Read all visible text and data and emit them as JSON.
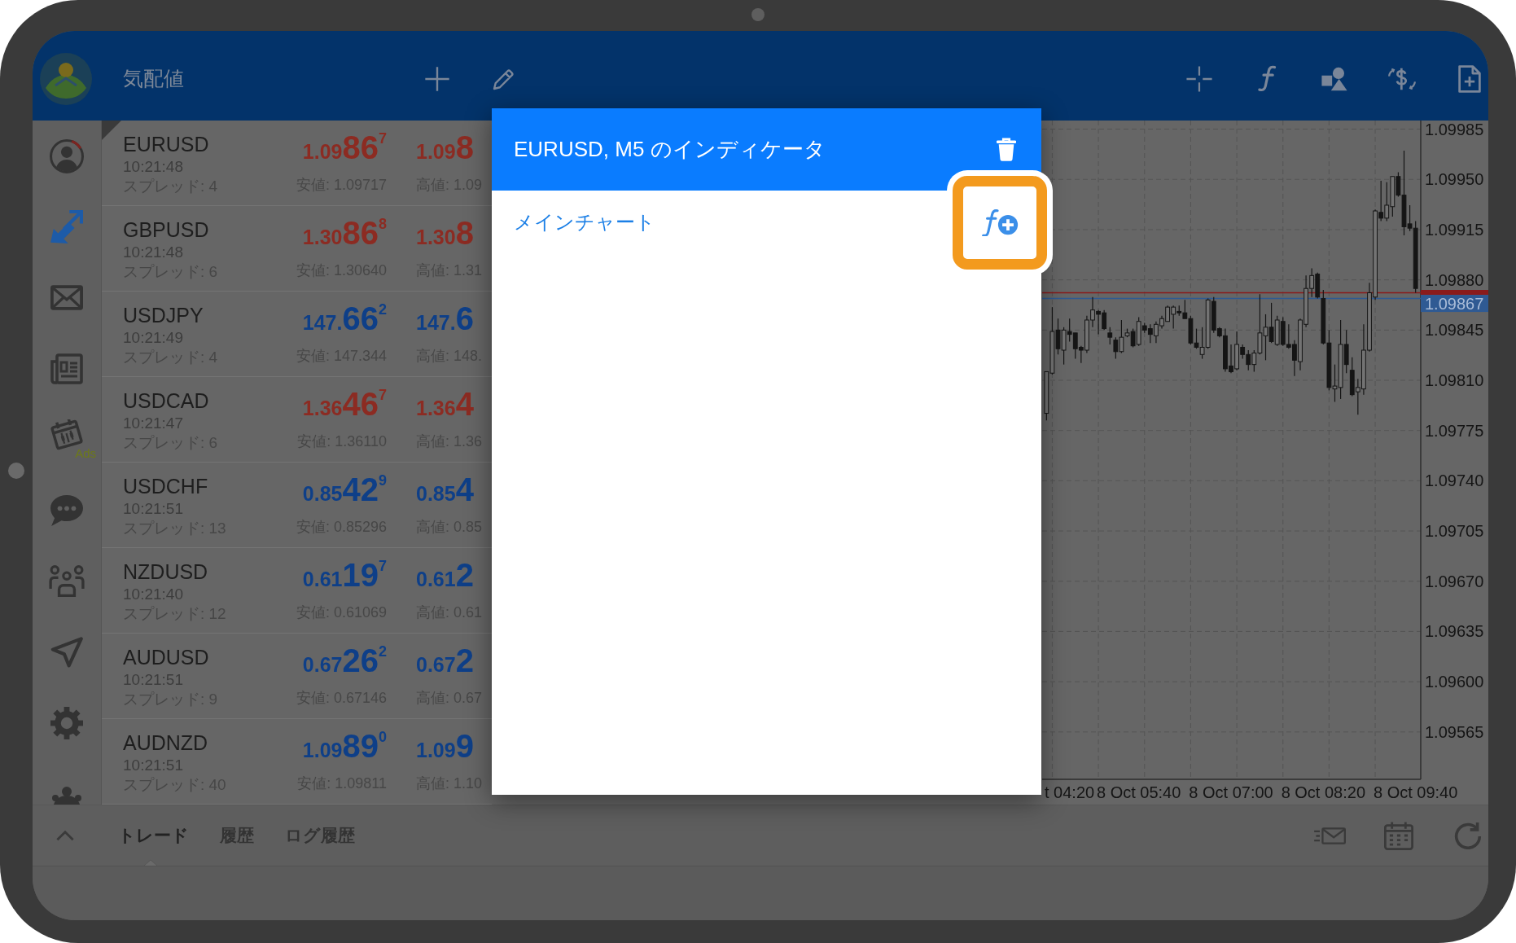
{
  "header": {
    "title": "気配値"
  },
  "sidebar": {
    "items": [
      {
        "selected": false
      },
      {
        "selected": true
      },
      {
        "selected": false
      },
      {
        "selected": false
      },
      {
        "selected": false,
        "badge": "Ads"
      },
      {
        "selected": false
      },
      {
        "selected": false
      },
      {
        "selected": false
      },
      {
        "selected": false
      },
      {
        "selected": false
      }
    ]
  },
  "quotes": [
    {
      "symbol": "EURUSD",
      "time": "10:21:48",
      "spread": "スプレッド: 4",
      "color": "#8c2b22",
      "selected": true,
      "bid": {
        "lead": "1.09",
        "big": "86",
        "sup": "7"
      },
      "low": "安値: 1.09717",
      "ask": {
        "lead": "1.09",
        "big": "8"
      },
      "high": "高値: 1.09"
    },
    {
      "symbol": "GBPUSD",
      "time": "10:21:48",
      "spread": "スプレッド: 6",
      "color": "#8c2b22",
      "selected": false,
      "bid": {
        "lead": "1.30",
        "big": "86",
        "sup": "8"
      },
      "low": "安値: 1.30640",
      "ask": {
        "lead": "1.30",
        "big": "8"
      },
      "high": "高値: 1.31"
    },
    {
      "symbol": "USDJPY",
      "time": "10:21:49",
      "spread": "スプレッド: 4",
      "color": "#0e3f88",
      "selected": false,
      "bid": {
        "lead": "147.",
        "big": "66",
        "sup": "2"
      },
      "low": "安値: 147.344",
      "ask": {
        "lead": "147.",
        "big": "6"
      },
      "high": "高値: 148."
    },
    {
      "symbol": "USDCAD",
      "time": "10:21:47",
      "spread": "スプレッド: 6",
      "color": "#8c2b22",
      "selected": false,
      "bid": {
        "lead": "1.36",
        "big": "46",
        "sup": "7"
      },
      "low": "安値: 1.36110",
      "ask": {
        "lead": "1.36",
        "big": "4"
      },
      "high": "高値: 1.36"
    },
    {
      "symbol": "USDCHF",
      "time": "10:21:51",
      "spread": "スプレッド: 13",
      "color": "#0e3f88",
      "selected": false,
      "bid": {
        "lead": "0.85",
        "big": "42",
        "sup": "9"
      },
      "low": "安値: 0.85296",
      "ask": {
        "lead": "0.85",
        "big": "4"
      },
      "high": "高値: 0.85"
    },
    {
      "symbol": "NZDUSD",
      "time": "10:21:40",
      "spread": "スプレッド: 12",
      "color": "#0e3f88",
      "selected": false,
      "bid": {
        "lead": "0.61",
        "big": "19",
        "sup": "7"
      },
      "low": "安値: 0.61069",
      "ask": {
        "lead": "0.61",
        "big": "2"
      },
      "high": "高値: 0.61"
    },
    {
      "symbol": "AUDUSD",
      "time": "10:21:51",
      "spread": "スプレッド: 9",
      "color": "#0e3f88",
      "selected": false,
      "bid": {
        "lead": "0.67",
        "big": "26",
        "sup": "2"
      },
      "low": "安値: 0.67146",
      "ask": {
        "lead": "0.67",
        "big": "2"
      },
      "high": "高値: 0.67"
    },
    {
      "symbol": "AUDNZD",
      "time": "10:21:51",
      "spread": "スプレッド: 40",
      "color": "#0e3f88",
      "selected": false,
      "bid": {
        "lead": "1.09",
        "big": "89",
        "sup": "0"
      },
      "low": "安値: 1.09811",
      "ask": {
        "lead": "1.09",
        "big": "9"
      },
      "high": "高値: 1.10"
    }
  ],
  "chart": {
    "clipped_time_label": "t 04:20",
    "chart_data": {
      "type": "candlestick",
      "categories": [
        null,
        null,
        null,
        null,
        null,
        null,
        null,
        null,
        null,
        null,
        null,
        null,
        null,
        null,
        null,
        null,
        "8 Oct 05:40",
        null,
        null,
        null,
        null,
        null,
        null,
        null,
        null,
        null,
        null,
        null,
        null,
        null,
        null,
        null,
        "8 Oct 07:00",
        null,
        null,
        null,
        null,
        null,
        null,
        null,
        null,
        null,
        null,
        null,
        null,
        null,
        null,
        null,
        "8 Oct 08:20",
        null,
        null,
        null,
        null,
        null,
        null,
        null,
        null,
        null,
        null,
        null,
        null,
        null,
        null,
        null,
        "8 Oct 09:40"
      ],
      "ohlc": [
        [
          1.09787,
          1.09816,
          1.09782,
          1.09816
        ],
        [
          1.09815,
          1.09861,
          1.09814,
          1.09844
        ],
        [
          1.09845,
          1.09853,
          1.09828,
          1.09832
        ],
        [
          1.09831,
          1.09847,
          1.09821,
          1.09845
        ],
        [
          1.09844,
          1.09853,
          1.09837,
          1.09842
        ],
        [
          1.09843,
          1.09843,
          1.09825,
          1.09832
        ],
        [
          1.09833,
          1.09834,
          1.09822,
          1.09831
        ],
        [
          1.09831,
          1.09855,
          1.09829,
          1.09852
        ],
        [
          1.09852,
          1.09868,
          1.09847,
          1.09859
        ],
        [
          1.09858,
          1.09859,
          1.09842,
          1.09856
        ],
        [
          1.09857,
          1.09859,
          1.09845,
          1.09846
        ],
        [
          1.09843,
          1.09847,
          1.09835,
          1.0984
        ],
        [
          1.09838,
          1.0984,
          1.09825,
          1.0983
        ],
        [
          1.0983,
          1.09852,
          1.09829,
          1.0984
        ],
        [
          1.09841,
          1.09846,
          1.0984,
          1.09843
        ],
        [
          1.09844,
          1.09846,
          1.09833,
          1.09834
        ],
        [
          1.09835,
          1.09854,
          1.09834,
          1.09851
        ],
        [
          1.09848,
          1.0985,
          1.09843,
          1.09845
        ],
        [
          1.09846,
          1.09849,
          1.09836,
          1.09842
        ],
        [
          1.09841,
          1.09851,
          1.09836,
          1.09849
        ],
        [
          1.09848,
          1.09855,
          1.09846,
          1.09853
        ],
        [
          1.09851,
          1.09862,
          1.09851,
          1.09861
        ],
        [
          1.09856,
          1.09862,
          1.09846,
          1.09861
        ],
        [
          1.09858,
          1.09862,
          1.09855,
          1.09857
        ],
        [
          1.09857,
          1.09866,
          1.09853,
          1.09853
        ],
        [
          1.09853,
          1.09855,
          1.09835,
          1.09836
        ],
        [
          1.09836,
          1.09846,
          1.09832,
          1.09833
        ],
        [
          1.09828,
          1.09847,
          1.09825,
          1.09833
        ],
        [
          1.09833,
          1.09867,
          1.09832,
          1.09866
        ],
        [
          1.09865,
          1.09868,
          1.09843,
          1.09845
        ],
        [
          1.09846,
          1.09847,
          1.0984,
          1.09841
        ],
        [
          1.09841,
          1.09846,
          1.09816,
          1.09818
        ],
        [
          1.0982,
          1.09835,
          1.09815,
          1.09816
        ],
        [
          1.09818,
          1.09844,
          1.09817,
          1.09835
        ],
        [
          1.09833,
          1.09835,
          1.09825,
          1.09828
        ],
        [
          1.09828,
          1.09831,
          1.09817,
          1.09821
        ],
        [
          1.09821,
          1.09831,
          1.09816,
          1.09829
        ],
        [
          1.09829,
          1.0987,
          1.09828,
          1.09843
        ],
        [
          1.09841,
          1.09856,
          1.09824,
          1.09847
        ],
        [
          1.09847,
          1.09864,
          1.09836,
          1.09837
        ],
        [
          1.09835,
          1.09855,
          1.09834,
          1.09852
        ],
        [
          1.09851,
          1.09854,
          1.09834,
          1.09835
        ],
        [
          1.09835,
          1.09849,
          1.09832,
          1.09833
        ],
        [
          1.09835,
          1.09838,
          1.09813,
          1.09824
        ],
        [
          1.09823,
          1.09853,
          1.09817,
          1.09852
        ],
        [
          1.09849,
          1.09883,
          1.09847,
          1.09874
        ],
        [
          1.09874,
          1.09888,
          1.09868,
          1.09883
        ],
        [
          1.09884,
          1.09885,
          1.09867,
          1.09868
        ],
        [
          1.09867,
          1.09873,
          1.09835,
          1.09836
        ],
        [
          1.09836,
          1.09845,
          1.09803,
          1.09805
        ],
        [
          1.09804,
          1.09821,
          1.09795,
          1.09806
        ],
        [
          1.09805,
          1.09852,
          1.09797,
          1.09835
        ],
        [
          1.09835,
          1.09845,
          1.09815,
          1.09821
        ],
        [
          1.09817,
          1.09826,
          1.09799,
          1.098
        ],
        [
          1.09802,
          1.09811,
          1.09786,
          1.09805
        ],
        [
          1.09804,
          1.09849,
          1.098,
          1.09831
        ],
        [
          1.09831,
          1.09878,
          1.0983,
          1.09871
        ],
        [
          1.09868,
          1.09929,
          1.09866,
          1.09928
        ],
        [
          1.09927,
          1.09949,
          1.09921,
          1.09923
        ],
        [
          1.09923,
          1.09948,
          1.09921,
          1.09932
        ],
        [
          1.09931,
          1.09952,
          1.09924,
          1.09952
        ],
        [
          1.09952,
          1.09955,
          1.09938,
          1.09939
        ],
        [
          1.09939,
          1.0997,
          1.09911,
          1.09917
        ],
        [
          1.09919,
          1.09932,
          1.09914,
          1.09916
        ],
        [
          1.09916,
          1.09921,
          1.09871,
          1.09874
        ]
      ],
      "ylim": [
        1.09532,
        1.09991
      ],
      "yticks": [
        {
          "value": 1.09985,
          "label": "1.09985"
        },
        {
          "value": 1.0995,
          "label": "1.09950"
        },
        {
          "value": 1.09915,
          "label": "1.09915"
        },
        {
          "value": 1.0988,
          "label": "1.09880"
        },
        {
          "value": 1.09845,
          "label": "1.09845"
        },
        {
          "value": 1.0981,
          "label": "1.09810"
        },
        {
          "value": 1.09775,
          "label": "1.09775"
        },
        {
          "value": 1.0974,
          "label": "1.09740"
        },
        {
          "value": 1.09705,
          "label": "1.09705"
        },
        {
          "value": 1.0967,
          "label": "1.09670"
        },
        {
          "value": 1.09635,
          "label": "1.09635"
        },
        {
          "value": 1.096,
          "label": "1.09600"
        },
        {
          "value": 1.09565,
          "label": "1.09565"
        }
      ],
      "grid": true,
      "ref_lines": [
        {
          "axis": "y",
          "value": 1.09871,
          "color": "#8a1b1b"
        },
        {
          "axis": "y",
          "value": 1.09867,
          "color": "#2f5a93",
          "label": "1.09867"
        }
      ]
    }
  },
  "dialog": {
    "title": "EURUSD, M5 のインディケータ",
    "sections": [
      {
        "label": "メインチャート",
        "highlighted": true
      }
    ]
  },
  "bottom_bar": {
    "tabs": [
      {
        "label": "トレード",
        "selected": true
      },
      {
        "label": "履歴",
        "selected": false
      },
      {
        "label": "ログ履歴",
        "selected": false
      }
    ]
  }
}
